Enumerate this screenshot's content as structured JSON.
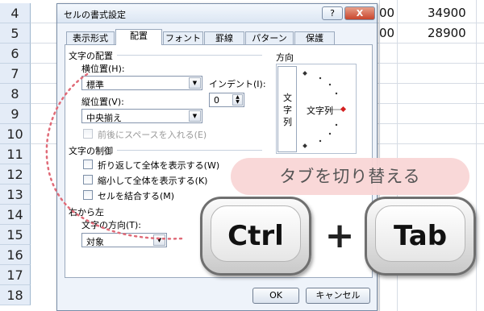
{
  "sheet": {
    "rows": [
      "4",
      "5",
      "6",
      "7",
      "8",
      "9",
      "10",
      "11",
      "12",
      "13",
      "14",
      "15",
      "16",
      "17",
      "18"
    ],
    "cells": [
      {
        "row": "4",
        "a": "00",
        "b": "34900"
      },
      {
        "row": "5",
        "a": "00",
        "b": "28900"
      }
    ]
  },
  "dialog": {
    "title": "セルの書式設定",
    "help_label": "?",
    "close_label": "X",
    "tabs": [
      "表示形式",
      "配置",
      "フォント",
      "罫線",
      "パターン",
      "保護"
    ],
    "active_tab": "配置",
    "text_alignment": {
      "group_label": "文字の配置",
      "horizontal_label": "横位置(H):",
      "horizontal_value": "標準",
      "indent_label": "インデント(I):",
      "indent_value": "0",
      "vertical_label": "縦位置(V):",
      "vertical_value": "中央揃え",
      "distributed_label": "前後にスペースを入れる(E)"
    },
    "text_control": {
      "group_label": "文字の制御",
      "wrap_label": "折り返して全体を表示する(W)",
      "shrink_label": "縮小して全体を表示する(K)",
      "merge_label": "セルを結合する(M)"
    },
    "rtl": {
      "group_label": "右から左",
      "direction_label": "文字の方向(T):",
      "direction_value": "対象"
    },
    "orientation": {
      "group_label": "方向",
      "vertical_text": [
        "文",
        "字",
        "列"
      ],
      "angle_text": "文字列"
    },
    "ok_label": "OK",
    "cancel_label": "キャンセル"
  },
  "overlay": {
    "banner_text": "タブを切り替える",
    "key1": "Ctrl",
    "plus": "+",
    "key2": "Tab"
  },
  "colors": {
    "banner_bg": "#f9d6d6",
    "dashed_arrow": "#e06b78",
    "row_header": "#e4ecf7",
    "dialog_bg": "#eef3fa"
  }
}
